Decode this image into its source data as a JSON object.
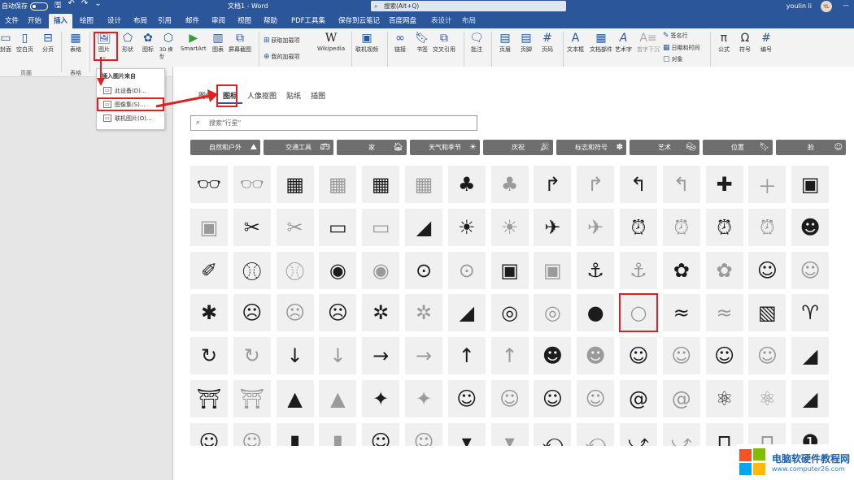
{
  "titlebar": {
    "autosave": "自动保存",
    "doc_title": "文档1 - Word",
    "search_placeholder": "搜索(Alt+Q)",
    "user_name": "youlin li",
    "user_initials": "YL"
  },
  "menu": {
    "tabs": [
      "文件",
      "开始",
      "插入",
      "绘图",
      "设计",
      "布局",
      "引用",
      "邮件",
      "审阅",
      "视图",
      "帮助",
      "PDF工具集",
      "保存到云笔记",
      "百度网盘",
      "表设计",
      "布局"
    ],
    "active_index": 2
  },
  "ribbon": {
    "cover": "封面",
    "blank_page": "空白页",
    "page_break": "分页",
    "table": "表格",
    "picture": "图片",
    "shapes": "形状",
    "icons": "图标",
    "models_3d": "3D 模型",
    "smartart": "SmartArt",
    "chart": "图表",
    "screenshot": "屏幕截图",
    "get_addins": "获取加载项",
    "my_addins": "我的加载项",
    "wikipedia": "Wikipedia",
    "online_video": "联机视频",
    "link": "链接",
    "bookmark": "书签",
    "cross_ref": "交叉引用",
    "comment": "批注",
    "header": "页眉",
    "footer": "页脚",
    "page_number": "页码",
    "textbox": "文本框",
    "quick_parts": "文档部件",
    "wordart": "艺术字",
    "dropcap": "首字下沉",
    "signature": "签名行",
    "datetime": "日期和时间",
    "object": "对象",
    "equation": "公式",
    "symbol": "符号",
    "numbering": "编号",
    "group_pages": "页面",
    "group_tables": "表格"
  },
  "dropdown": {
    "header": "插入图片来自",
    "items": [
      "此设备(D)...",
      "图像集(S)...",
      "联机图片(O)..."
    ]
  },
  "dialog": {
    "tabs": [
      "图像",
      "图标",
      "人像抠图",
      "贴纸",
      "插图"
    ],
    "active_tab": 1,
    "search_placeholder": "搜索\"行星\"",
    "categories": [
      "自然和户外",
      "交通工具",
      "家",
      "天气和季节",
      "庆祝",
      "标志和符号",
      "艺术",
      "位置",
      "脸"
    ]
  },
  "icons": [
    [
      "3d-glasses",
      "3d-glasses-outline",
      "abacus",
      "abacus-outline",
      "abacus-2",
      "abacus-2-outline",
      "acorn",
      "acorn-outline",
      "arrow-turn",
      "arrow-turn-outline",
      "arrow-back-turn",
      "arrow-back-turn-outline",
      "plus",
      "plus-outline",
      "address-book"
    ],
    [
      "address-book-outline",
      "bandage",
      "bandage-outline",
      "billboard",
      "billboard-outline",
      "africa",
      "farm",
      "farm-outline",
      "airplane",
      "airplane-outline",
      "alarm-clock",
      "alarm-clock-outline",
      "alarm-ringing",
      "alarm-ringing-outline",
      "alien"
    ],
    [
      "knitting",
      "yarn",
      "yarn-outline",
      "measuring-tape",
      "measuring-tape-outline",
      "button",
      "button-outline",
      "ambulance",
      "ambulance-outline",
      "anchor",
      "anchor-outline",
      "anemone",
      "anemone-outline",
      "angel-face",
      "angel-face-outline"
    ],
    [
      "angry",
      "angry-face",
      "angry-face-outline",
      "angry-face-2",
      "ant",
      "ant-outline",
      "antarctica",
      "aperture",
      "aperture-outline",
      "apple",
      "apple-outline",
      "water-waves",
      "water-waves-outline",
      "chart-board",
      "aries"
    ],
    [
      "refresh",
      "refresh-outline",
      "arrow-down",
      "arrow-down-outline",
      "arrow-right",
      "arrow-right-outline",
      "arrow-up",
      "arrow-up-outline",
      "ai-head",
      "ai-head-outline",
      "artist",
      "artist-outline",
      "painter",
      "painter-outline",
      "asia"
    ],
    [
      "torii",
      "torii-outline",
      "climber",
      "climber-outline",
      "athlete",
      "athlete-outline",
      "astronaut",
      "astronaut-outline",
      "astronaut-2",
      "astronaut-2-outline",
      "at-sign",
      "at-sign-outline",
      "atom",
      "atom-outline",
      "australia"
    ],
    [
      "baby",
      "baby-outline",
      "baby-bottle",
      "baby-bottle-outline",
      "crawling-baby",
      "crawling-baby-outline",
      "baby-onesie",
      "baby-onesie-outline",
      "back-arrow",
      "back-arrow-outline",
      "forward-arrow",
      "forward-arrow-outline",
      "bag",
      "bag-outline",
      "badge-1"
    ]
  ],
  "selected_icon": "apple-outline",
  "watermark": {
    "name": "电脑软硬件教程网",
    "url": "www.computer26.com"
  }
}
